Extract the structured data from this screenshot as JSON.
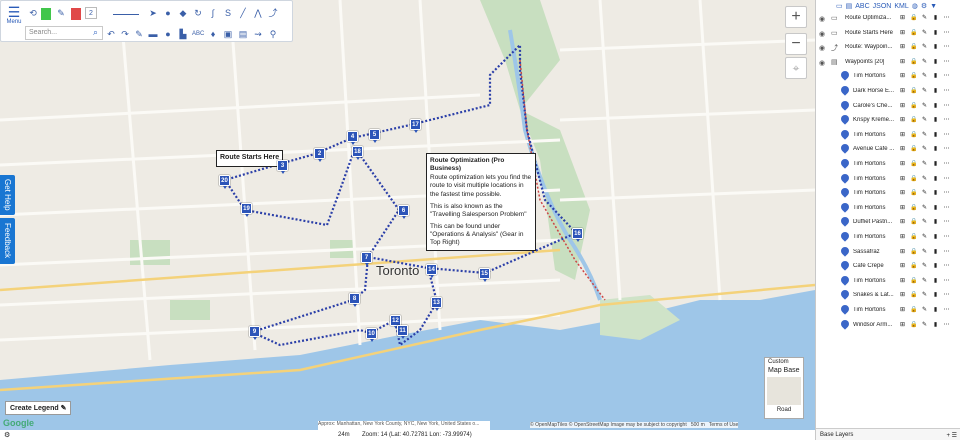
{
  "toolbar": {
    "menu_label": "Menu",
    "search_placeholder": "Search...",
    "line_width_value": "2",
    "abc_label": "ABC",
    "colors": {
      "fill": "#41c64b",
      "stroke": "#e04848"
    }
  },
  "map": {
    "city_label": "Toronto",
    "route_label": "Route Starts Here",
    "popup": {
      "title": "Route Optimization (Pro Business)",
      "line1": "Route optimization lets you find the route to visit multiple locations in the fastest time possible.",
      "line2": "This is also known as the \"Travelling Salesperson Problem\"",
      "line3": "This can be found under \"Operations & Analysis\" (Gear in Top Right)"
    },
    "markers": [
      "2",
      "5",
      "18",
      "17",
      "4",
      "3",
      "20",
      "19",
      "6",
      "7",
      "14",
      "15",
      "16",
      "8",
      "13",
      "9",
      "10",
      "12",
      "11",
      "1"
    ],
    "zoom_in": "+",
    "zoom_out": "−",
    "get_help": "Get Help",
    "feedback": "Feedback",
    "create_legend": "Create Legend",
    "basemap": {
      "custom": "Custom",
      "title": "Map Base",
      "road": "Road"
    },
    "status_text": "Approx: Manhattan, New York County, NYC, New York, United States o...",
    "bottom": {
      "distance": "24m",
      "zoom": "Zoom: 14 (Lat: 40.72781 Lon: -73.99974)"
    },
    "attribution": "© OpenMapTiles © OpenStreetMap   Image may be subject to copyright",
    "scale": "500 m",
    "terms": "Terms of Use",
    "google": "Google"
  },
  "layers": {
    "toolbar_icons": [
      "ABC",
      "JSON",
      "KML"
    ],
    "items": [
      {
        "name": "Route Optimiza...",
        "type": "text"
      },
      {
        "name": "Route Starts Here",
        "type": "text"
      },
      {
        "name": "Route: Waypoin...",
        "type": "route"
      },
      {
        "name": "Waypoints [20]",
        "type": "folder"
      },
      {
        "name": "Tim Hortons",
        "type": "pin"
      },
      {
        "name": "Dark Horse E...",
        "type": "pin"
      },
      {
        "name": "Carole's Che...",
        "type": "pin"
      },
      {
        "name": "Krispy Kreme...",
        "type": "pin"
      },
      {
        "name": "Tim Hortons",
        "type": "pin"
      },
      {
        "name": "Avenue Cafe ...",
        "type": "pin"
      },
      {
        "name": "Tim Hortons",
        "type": "pin"
      },
      {
        "name": "Tim Hortons",
        "type": "pin"
      },
      {
        "name": "Tim Hortons",
        "type": "pin"
      },
      {
        "name": "Tim Hortons",
        "type": "pin"
      },
      {
        "name": "Duffiet Pastri...",
        "type": "pin"
      },
      {
        "name": "Tim Hortons",
        "type": "pin"
      },
      {
        "name": "Sassafraz",
        "type": "pin"
      },
      {
        "name": "Cafe Crepe",
        "type": "pin"
      },
      {
        "name": "Tim Hortons",
        "type": "pin"
      },
      {
        "name": "Snakes & Lat...",
        "type": "pin"
      },
      {
        "name": "Tim Hortons",
        "type": "pin"
      },
      {
        "name": "Windsor Arm...",
        "type": "pin"
      }
    ],
    "footer": "Base Layers"
  }
}
